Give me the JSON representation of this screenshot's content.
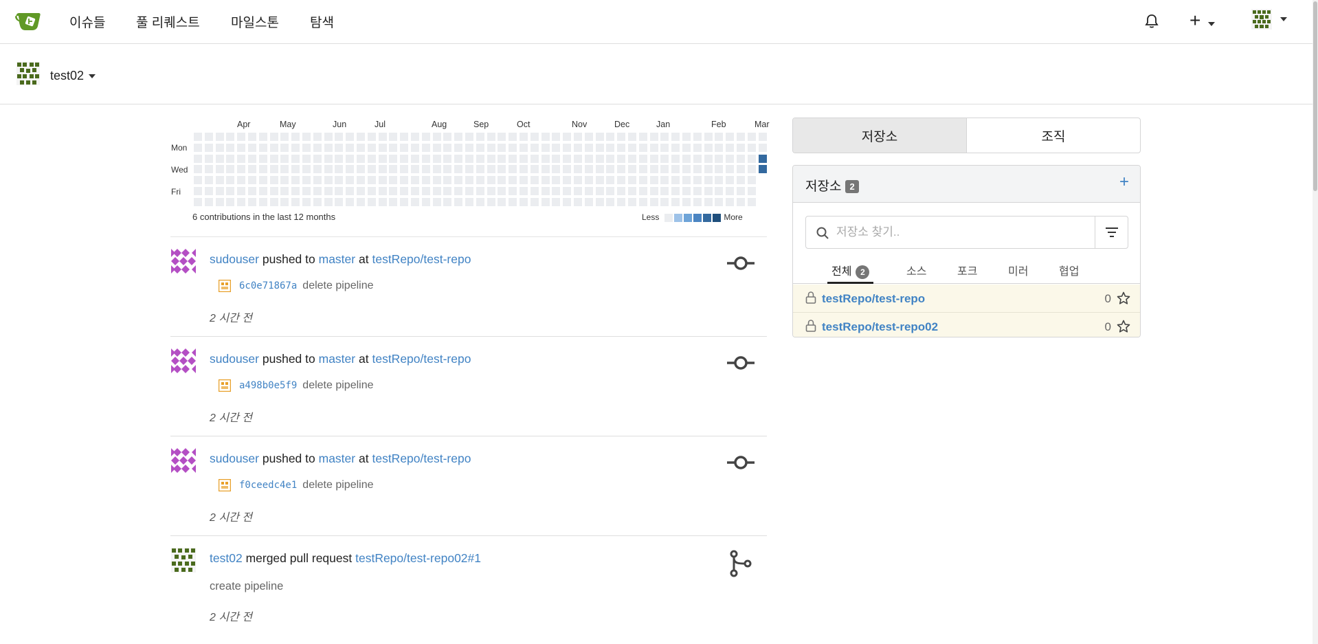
{
  "nav": {
    "items": [
      "이슈들",
      "풀 리퀘스트",
      "마일스톤",
      "탐색"
    ],
    "plus_label": "+"
  },
  "context": {
    "name": "test02"
  },
  "heatmap": {
    "months": [
      "Apr",
      "May",
      "Jun",
      "Jul",
      "Aug",
      "Sep",
      "Oct",
      "Nov",
      "Dec",
      "Jan",
      "Feb",
      "Mar"
    ],
    "days": [
      "Mon",
      "Wed",
      "Fri"
    ],
    "summary": "6 contributions in the last 12 months",
    "less": "Less",
    "more": "More",
    "colors": [
      "#ebedf0",
      "#9ec2e8",
      "#6ea4d8",
      "#4b85c2",
      "#33699f",
      "#1f4f7c"
    ]
  },
  "feed": [
    {
      "type": "push",
      "user": "sudouser",
      "verb": "pushed to",
      "branch": "master",
      "at": "at",
      "repo": "testRepo/test-repo",
      "sha": "6c0e71867a",
      "message": "delete pipeline",
      "time": "2 시간 전"
    },
    {
      "type": "push",
      "user": "sudouser",
      "verb": "pushed to",
      "branch": "master",
      "at": "at",
      "repo": "testRepo/test-repo",
      "sha": "a498b0e5f9",
      "message": "delete pipeline",
      "time": "2 시간 전"
    },
    {
      "type": "push",
      "user": "sudouser",
      "verb": "pushed to",
      "branch": "master",
      "at": "at",
      "repo": "testRepo/test-repo",
      "sha": "f0ceedc4e1",
      "message": "delete pipeline",
      "time": "2 시간 전"
    },
    {
      "type": "merge",
      "user": "test02",
      "verb": "merged pull request",
      "repo": "testRepo/test-repo02#1",
      "message": "create pipeline",
      "time": "2 시간 전"
    }
  ],
  "panel": {
    "tabs": [
      "저장소",
      "조직"
    ],
    "title": "저장소",
    "count": "2",
    "plus": "+",
    "search_placeholder": "저장소 찾기..",
    "subtabs": [
      "전체",
      "소스",
      "포크",
      "미러",
      "협업"
    ],
    "all_count": "2",
    "repos": [
      {
        "name": "testRepo/test-repo",
        "stars": "0"
      },
      {
        "name": "testRepo/test-repo02",
        "stars": "0"
      }
    ]
  }
}
